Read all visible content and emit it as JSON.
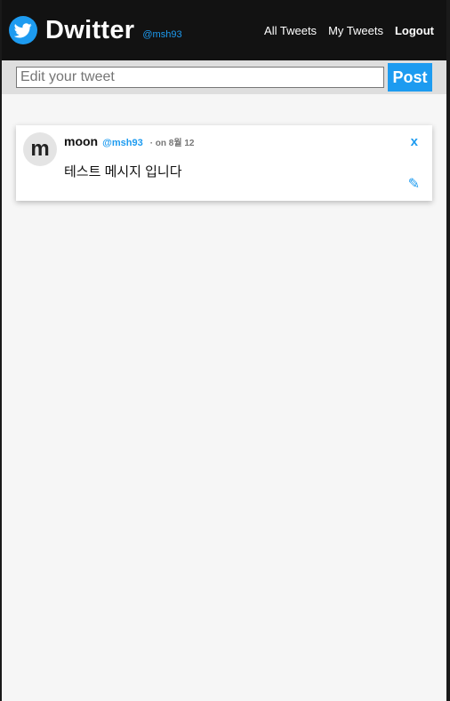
{
  "header": {
    "brand": "Dwitter",
    "user_handle": "@msh93",
    "nav": {
      "all_tweets": "All Tweets",
      "my_tweets": "My Tweets",
      "logout": "Logout"
    }
  },
  "edit_bar": {
    "placeholder": "Edit your tweet",
    "value": "",
    "post_label": "Post"
  },
  "tweets": [
    {
      "avatar_letter": "m",
      "author": "moon",
      "handle": "@msh93",
      "date": "· on 8월 12",
      "text": "테스트 메시지 입니다",
      "delete_label": "x",
      "edit_label": "✎"
    }
  ],
  "colors": {
    "accent": "#1d9bf0",
    "header_bg": "#121212",
    "page_bg": "#f6f6f6"
  },
  "icons": {
    "logo": "twitter-bird-icon",
    "edit": "pencil-icon",
    "delete": "x-icon"
  }
}
